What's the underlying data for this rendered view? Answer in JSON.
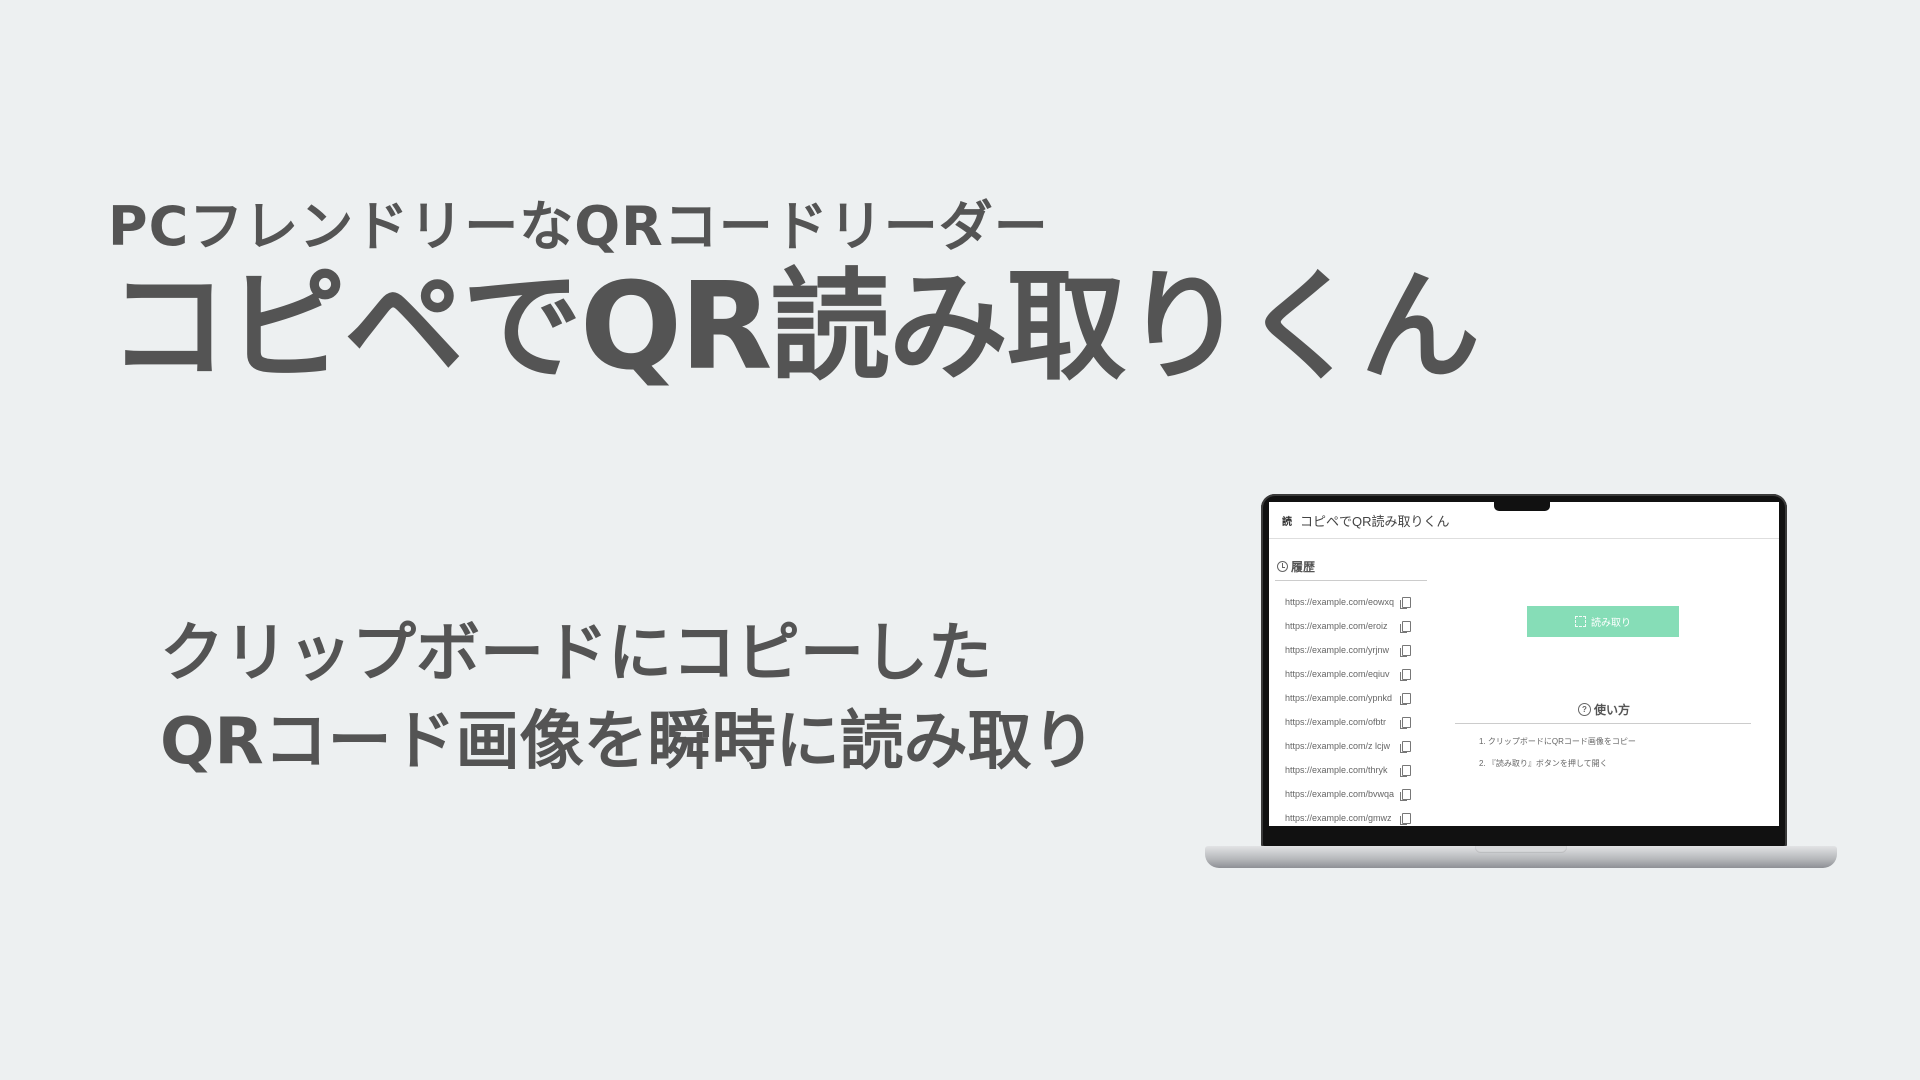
{
  "hero": {
    "subtitle": "PCフレンドリーなQRコードリーダー",
    "title": "コピペでQR読み取りくん",
    "tagline_lines": [
      "クリップボードにコピーした",
      "QRコード画像を瞬時に読み取り"
    ]
  },
  "app": {
    "header_title": "コピペでQR読み取りくん",
    "logo_glyph": "読",
    "history": {
      "title": "履歴",
      "items": [
        "https://example.com/eowxq",
        "https://example.com/eroiz",
        "https://example.com/yrjnw",
        "https://example.com/eqiuv",
        "https://example.com/ypnkd",
        "https://example.com/ofbtr",
        "https://example.com/z lcjw",
        "https://example.com/thryk",
        "https://example.com/bvwqa",
        "https://example.com/gmwz"
      ]
    },
    "read_button_label": "読み取り",
    "usage": {
      "title": "使い方",
      "help_glyph": "?",
      "steps": [
        "1. クリップボードにQRコード画像をコピー",
        "2. 『読み取り』ボタンを押して開く"
      ]
    }
  },
  "colors": {
    "background": "#edf0f1",
    "text": "#545454",
    "button": "#86ddb7"
  },
  "icons": {
    "history": "clock-icon",
    "copy": "copy-icon",
    "scan": "scan-icon",
    "help": "help-icon"
  }
}
